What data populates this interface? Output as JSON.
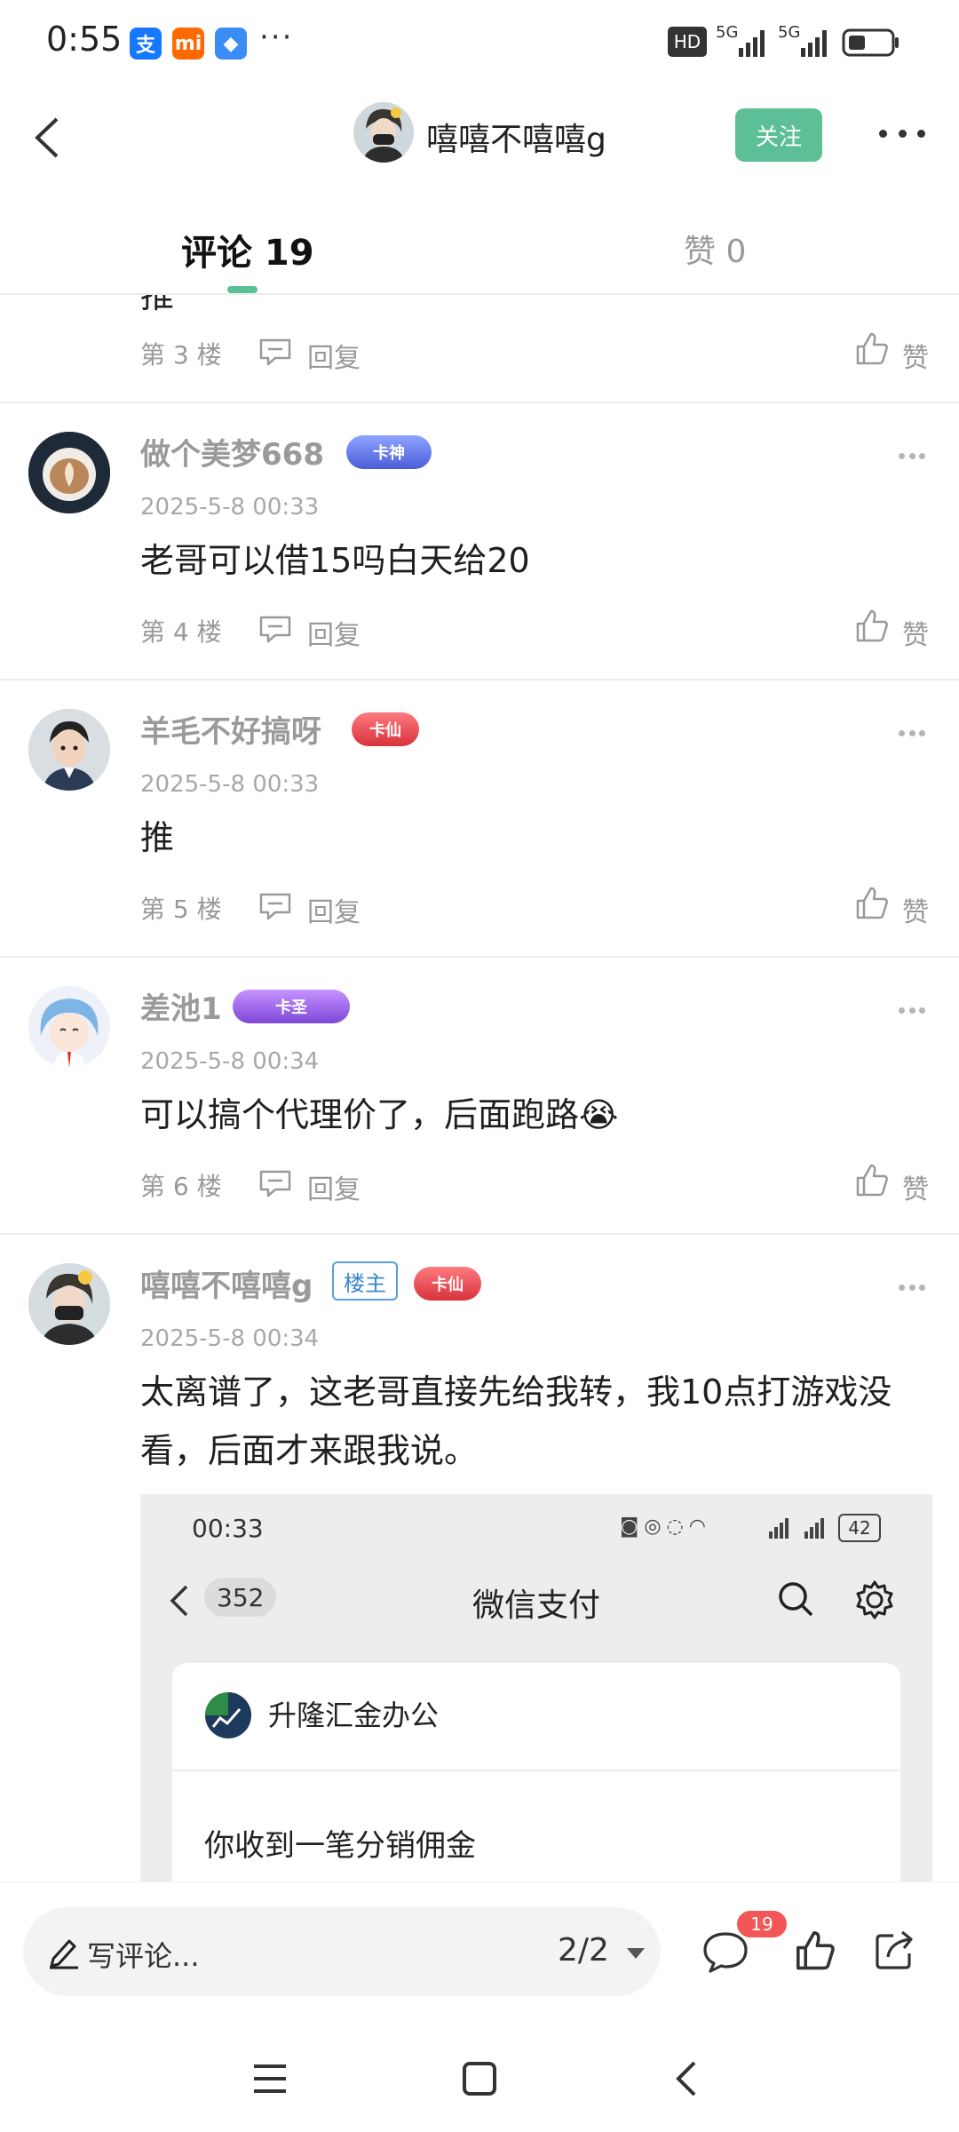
{
  "status_bar": {
    "time": "0:55",
    "icons": [
      "alipay-icon",
      "mi-icon",
      "cloud-app-icon"
    ],
    "more": "···",
    "network": "HD",
    "signal1": "5G",
    "signal2": "5G"
  },
  "header": {
    "title": "嘻嘻不嘻嘻g",
    "follow_label": "关注"
  },
  "tabs": {
    "comments_label": "评论 19",
    "likes_label": "赞 0"
  },
  "partial_comment": {
    "text": "推",
    "floor": "第 3 楼",
    "reply": "回复",
    "like": "赞"
  },
  "comments": [
    {
      "username": "做个美梦668",
      "badge": "卡神",
      "time": "2025-5-8 00:33",
      "text": "老哥可以借15吗白天给20",
      "floor": "第 4 楼",
      "reply": "回复",
      "like": "赞"
    },
    {
      "username": "羊毛不好搞呀",
      "badge": "卡仙",
      "time": "2025-5-8 00:33",
      "text": "推",
      "floor": "第 5 楼",
      "reply": "回复",
      "like": "赞"
    },
    {
      "username": "差池1",
      "badge": "卡圣",
      "time": "2025-5-8 00:34",
      "text": "可以搞个代理价了，后面跑路",
      "emoji": "😭",
      "floor": "第 6 楼",
      "reply": "回复",
      "like": "赞"
    },
    {
      "username": "嘻嘻不嘻嘻g",
      "host_tag": "楼主",
      "badge": "卡仙",
      "time": "2025-5-8 00:34",
      "text": "太离谱了，这老哥直接先给我转，我10点打游戏没看，后面才来跟我说。"
    }
  ],
  "embedded_screenshot": {
    "time": "00:33",
    "battery": "42",
    "back_count": "352",
    "title": "微信支付",
    "merchant": "升隆汇金办公",
    "message": "你收到一笔分销佣金"
  },
  "bottom_bar": {
    "placeholder": "写评论...",
    "page": "2/2",
    "comment_count": "19"
  },
  "colors": {
    "accent": "#5cbf95",
    "badge_red": "#e8434b"
  }
}
